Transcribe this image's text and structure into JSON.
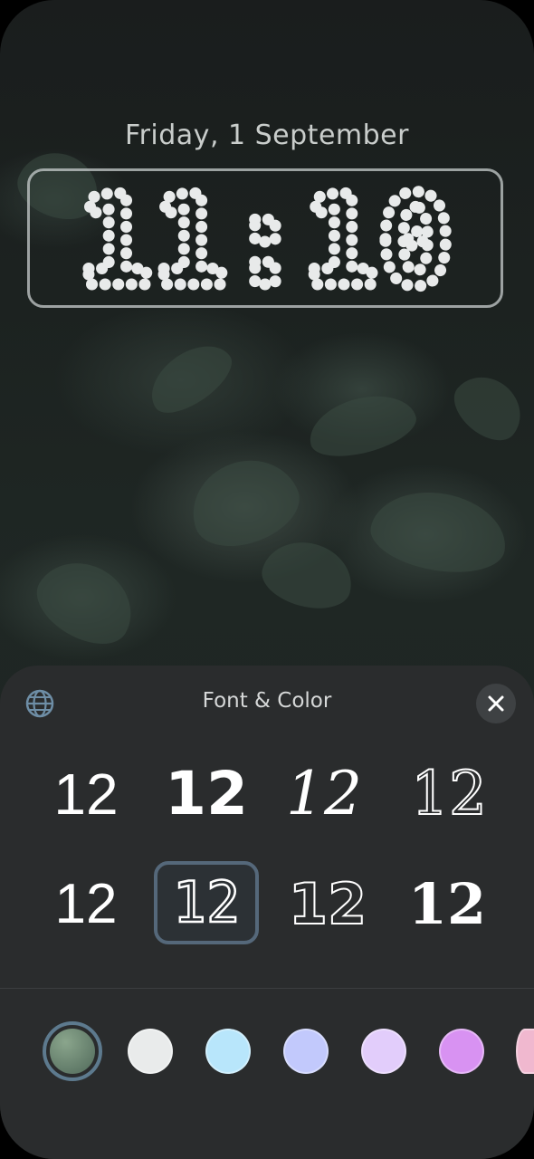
{
  "lock_screen": {
    "date": "Friday, 1 September",
    "time": "11:10"
  },
  "sheet": {
    "title": "Font & Color",
    "globe_icon": "globe-icon",
    "close_icon": "close-icon",
    "font_options": [
      {
        "label": "12",
        "style": "rounded"
      },
      {
        "label": "12",
        "style": "drip"
      },
      {
        "label": "12",
        "style": "brush"
      },
      {
        "label": "12",
        "style": "outline"
      },
      {
        "label": "12",
        "style": "rounded-narrow"
      },
      {
        "label": "12",
        "style": "dotted",
        "selected": true
      },
      {
        "label": "12",
        "style": "cracked"
      },
      {
        "label": "12",
        "style": "stencil"
      }
    ],
    "colors": [
      {
        "hex": "#6f8f73",
        "selected": true
      },
      {
        "hex": "#e9ebeb"
      },
      {
        "hex": "#b8e6fb"
      },
      {
        "hex": "#c2c9fc"
      },
      {
        "hex": "#e2cdfb"
      },
      {
        "hex": "#d892f2"
      },
      {
        "hex": "#f0b8cf"
      }
    ]
  }
}
